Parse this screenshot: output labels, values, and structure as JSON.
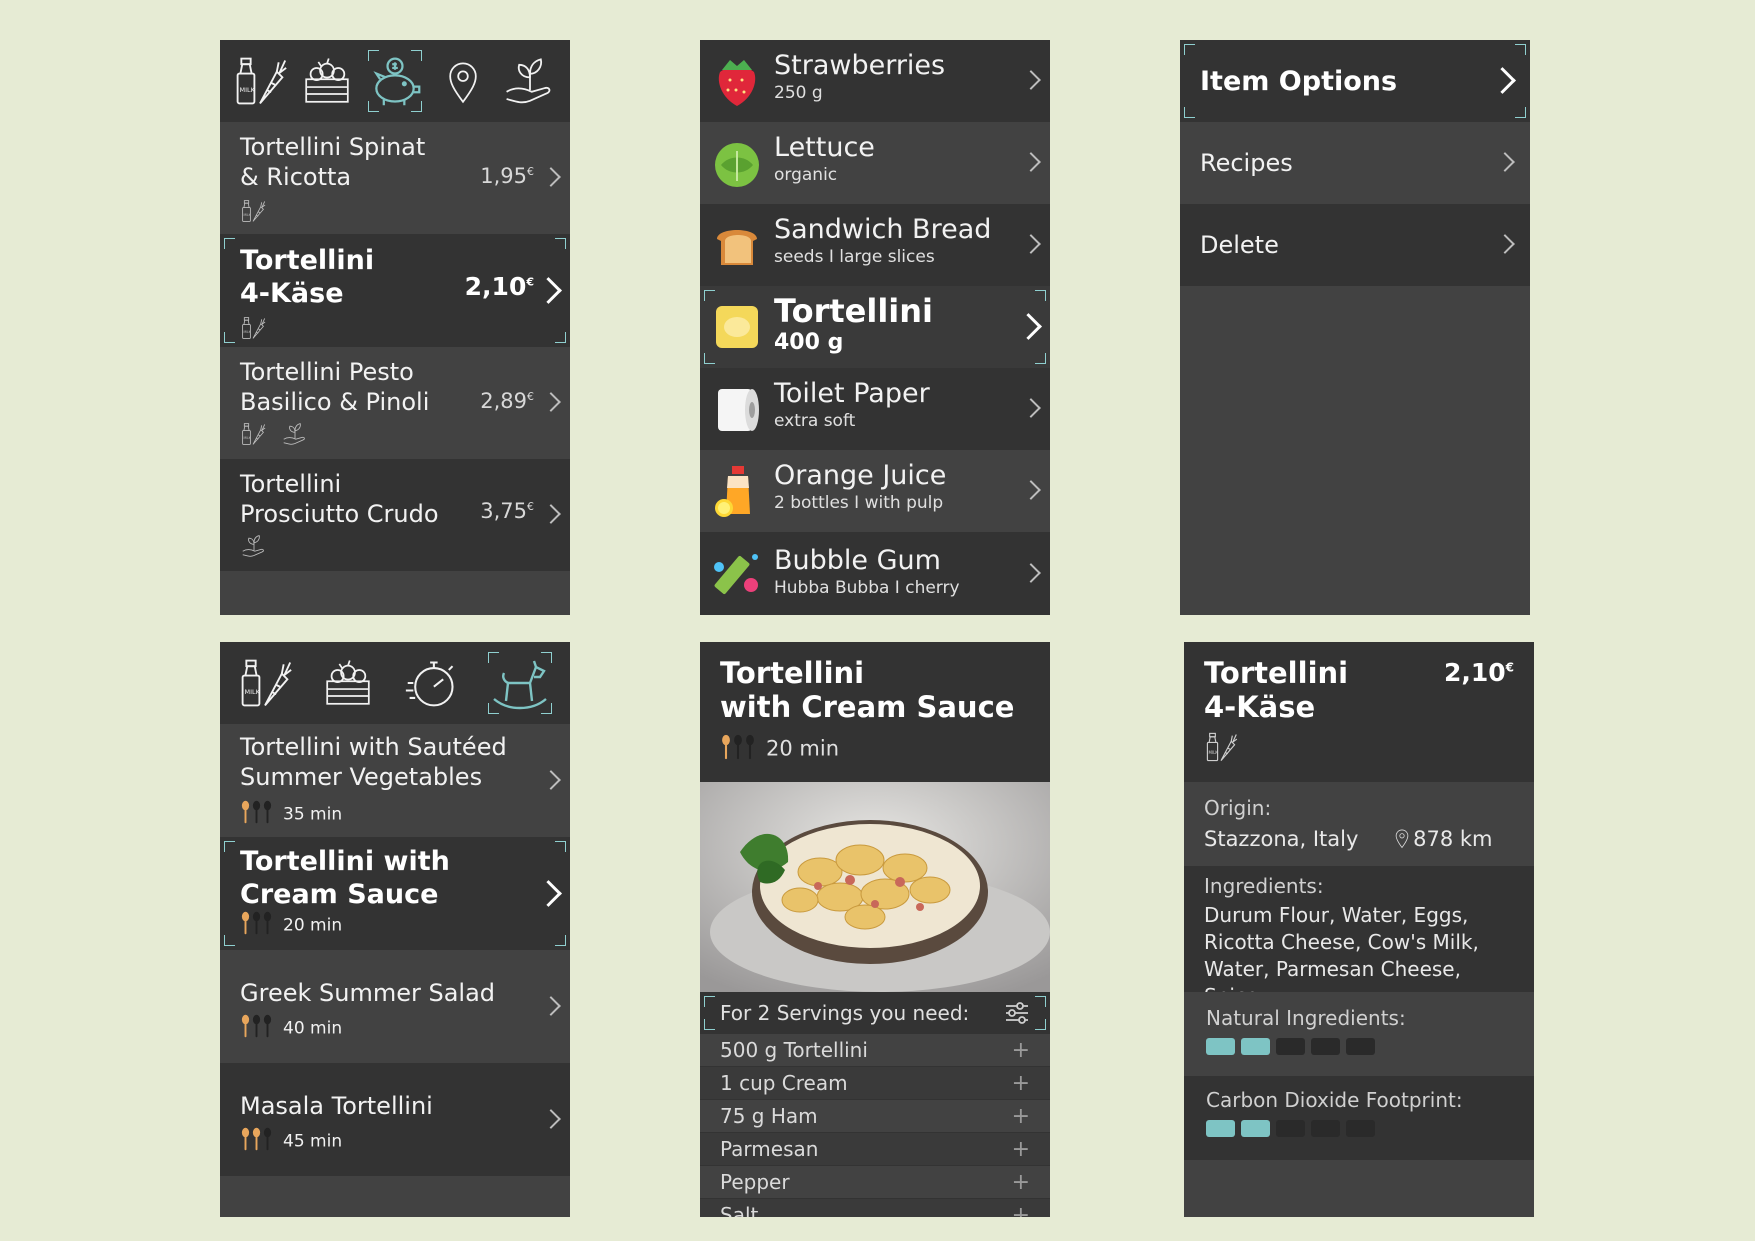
{
  "colors": {
    "background": "#e6ebd4",
    "accent": "#7ec4c4",
    "panel_dark": "#333333",
    "panel_mid": "#424242"
  },
  "products_list": {
    "icons": [
      "milk-carrot-icon",
      "vegetable-crate-icon",
      "piggy-bank-icon",
      "location-pin-icon",
      "plant-hand-icon"
    ],
    "items": [
      {
        "name": "Tortellini Spinat & Ricotta",
        "price": "1,95",
        "currency": "€",
        "tags": [
          "milk-carrot-icon"
        ]
      },
      {
        "name": "Tortellini 4-Käse",
        "price": "2,10",
        "currency": "€",
        "tags": [
          "milk-carrot-icon"
        ],
        "selected": true
      },
      {
        "name": "Tortellini Pesto Basilico & Pinoli",
        "price": "2,89",
        "currency": "€",
        "tags": [
          "milk-carrot-icon",
          "plant-hand-icon"
        ]
      },
      {
        "name": "Tortellini Prosciutto Crudo",
        "price": "3,75",
        "currency": "€",
        "tags": [
          "plant-hand-icon"
        ]
      }
    ]
  },
  "shopping_list": {
    "items": [
      {
        "name": "Strawberries",
        "detail": "250 g",
        "icon": "strawberry-icon"
      },
      {
        "name": "Lettuce",
        "detail": "organic",
        "icon": "lettuce-icon"
      },
      {
        "name": "Sandwich Bread",
        "detail": "seeds I large slices",
        "icon": "bread-icon"
      },
      {
        "name": "Tortellini",
        "detail": "400 g",
        "icon": "tortellini-icon",
        "selected": true
      },
      {
        "name": "Toilet Paper",
        "detail": "extra soft",
        "icon": "toilet-paper-icon"
      },
      {
        "name": "Orange Juice",
        "detail": "2 bottles I with pulp",
        "icon": "orange-juice-icon"
      },
      {
        "name": "Bubble Gum",
        "detail": "Hubba Bubba I cherry",
        "icon": "bubble-gum-icon"
      }
    ]
  },
  "item_options": {
    "title": "Item Options",
    "items": [
      "Recipes",
      "Delete"
    ]
  },
  "recipes_list": {
    "icons": [
      "milk-carrot-icon",
      "vegetable-crate-icon",
      "stopwatch-icon",
      "rocking-horse-icon"
    ],
    "items": [
      {
        "name": "Tortellini with Sautéed Summer Vegetables",
        "time": "35 min",
        "difficulty": 1
      },
      {
        "name": "Tortellini with Cream Sauce",
        "time": "20 min",
        "difficulty": 1,
        "selected": true
      },
      {
        "name": "Greek Summer Salad",
        "time": "40 min",
        "difficulty": 1
      },
      {
        "name": "Masala Tortellini",
        "time": "45 min",
        "difficulty": 2
      }
    ]
  },
  "recipe_detail": {
    "title_line1": "Tortellini",
    "title_line2": "with Cream Sauce",
    "time": "20 min",
    "servings_label": "For 2 Servings you need:",
    "ingredients": [
      "500 g Tortellini",
      "1 cup Cream",
      "75 g Ham",
      "Parmesan",
      "Pepper",
      "Salt"
    ]
  },
  "product_detail": {
    "title_line1": "Tortellini",
    "title_line2": "4-Käse",
    "price": "2,10",
    "currency": "€",
    "origin_label": "Origin:",
    "origin_value": "Stazzona, Italy",
    "distance": "878 km",
    "ingredients_label": "Ingredients:",
    "ingredients_lines": [
      "Durum Flour, Water, Eggs,",
      "Ricotta Cheese, Cow's Milk,",
      "Water, Parmesan Cheese, Spice"
    ],
    "natural_label": "Natural Ingredients:",
    "natural_score": 2,
    "co2_label": "Carbon Dioxide Footprint:",
    "co2_score": 2,
    "score_max": 5
  }
}
